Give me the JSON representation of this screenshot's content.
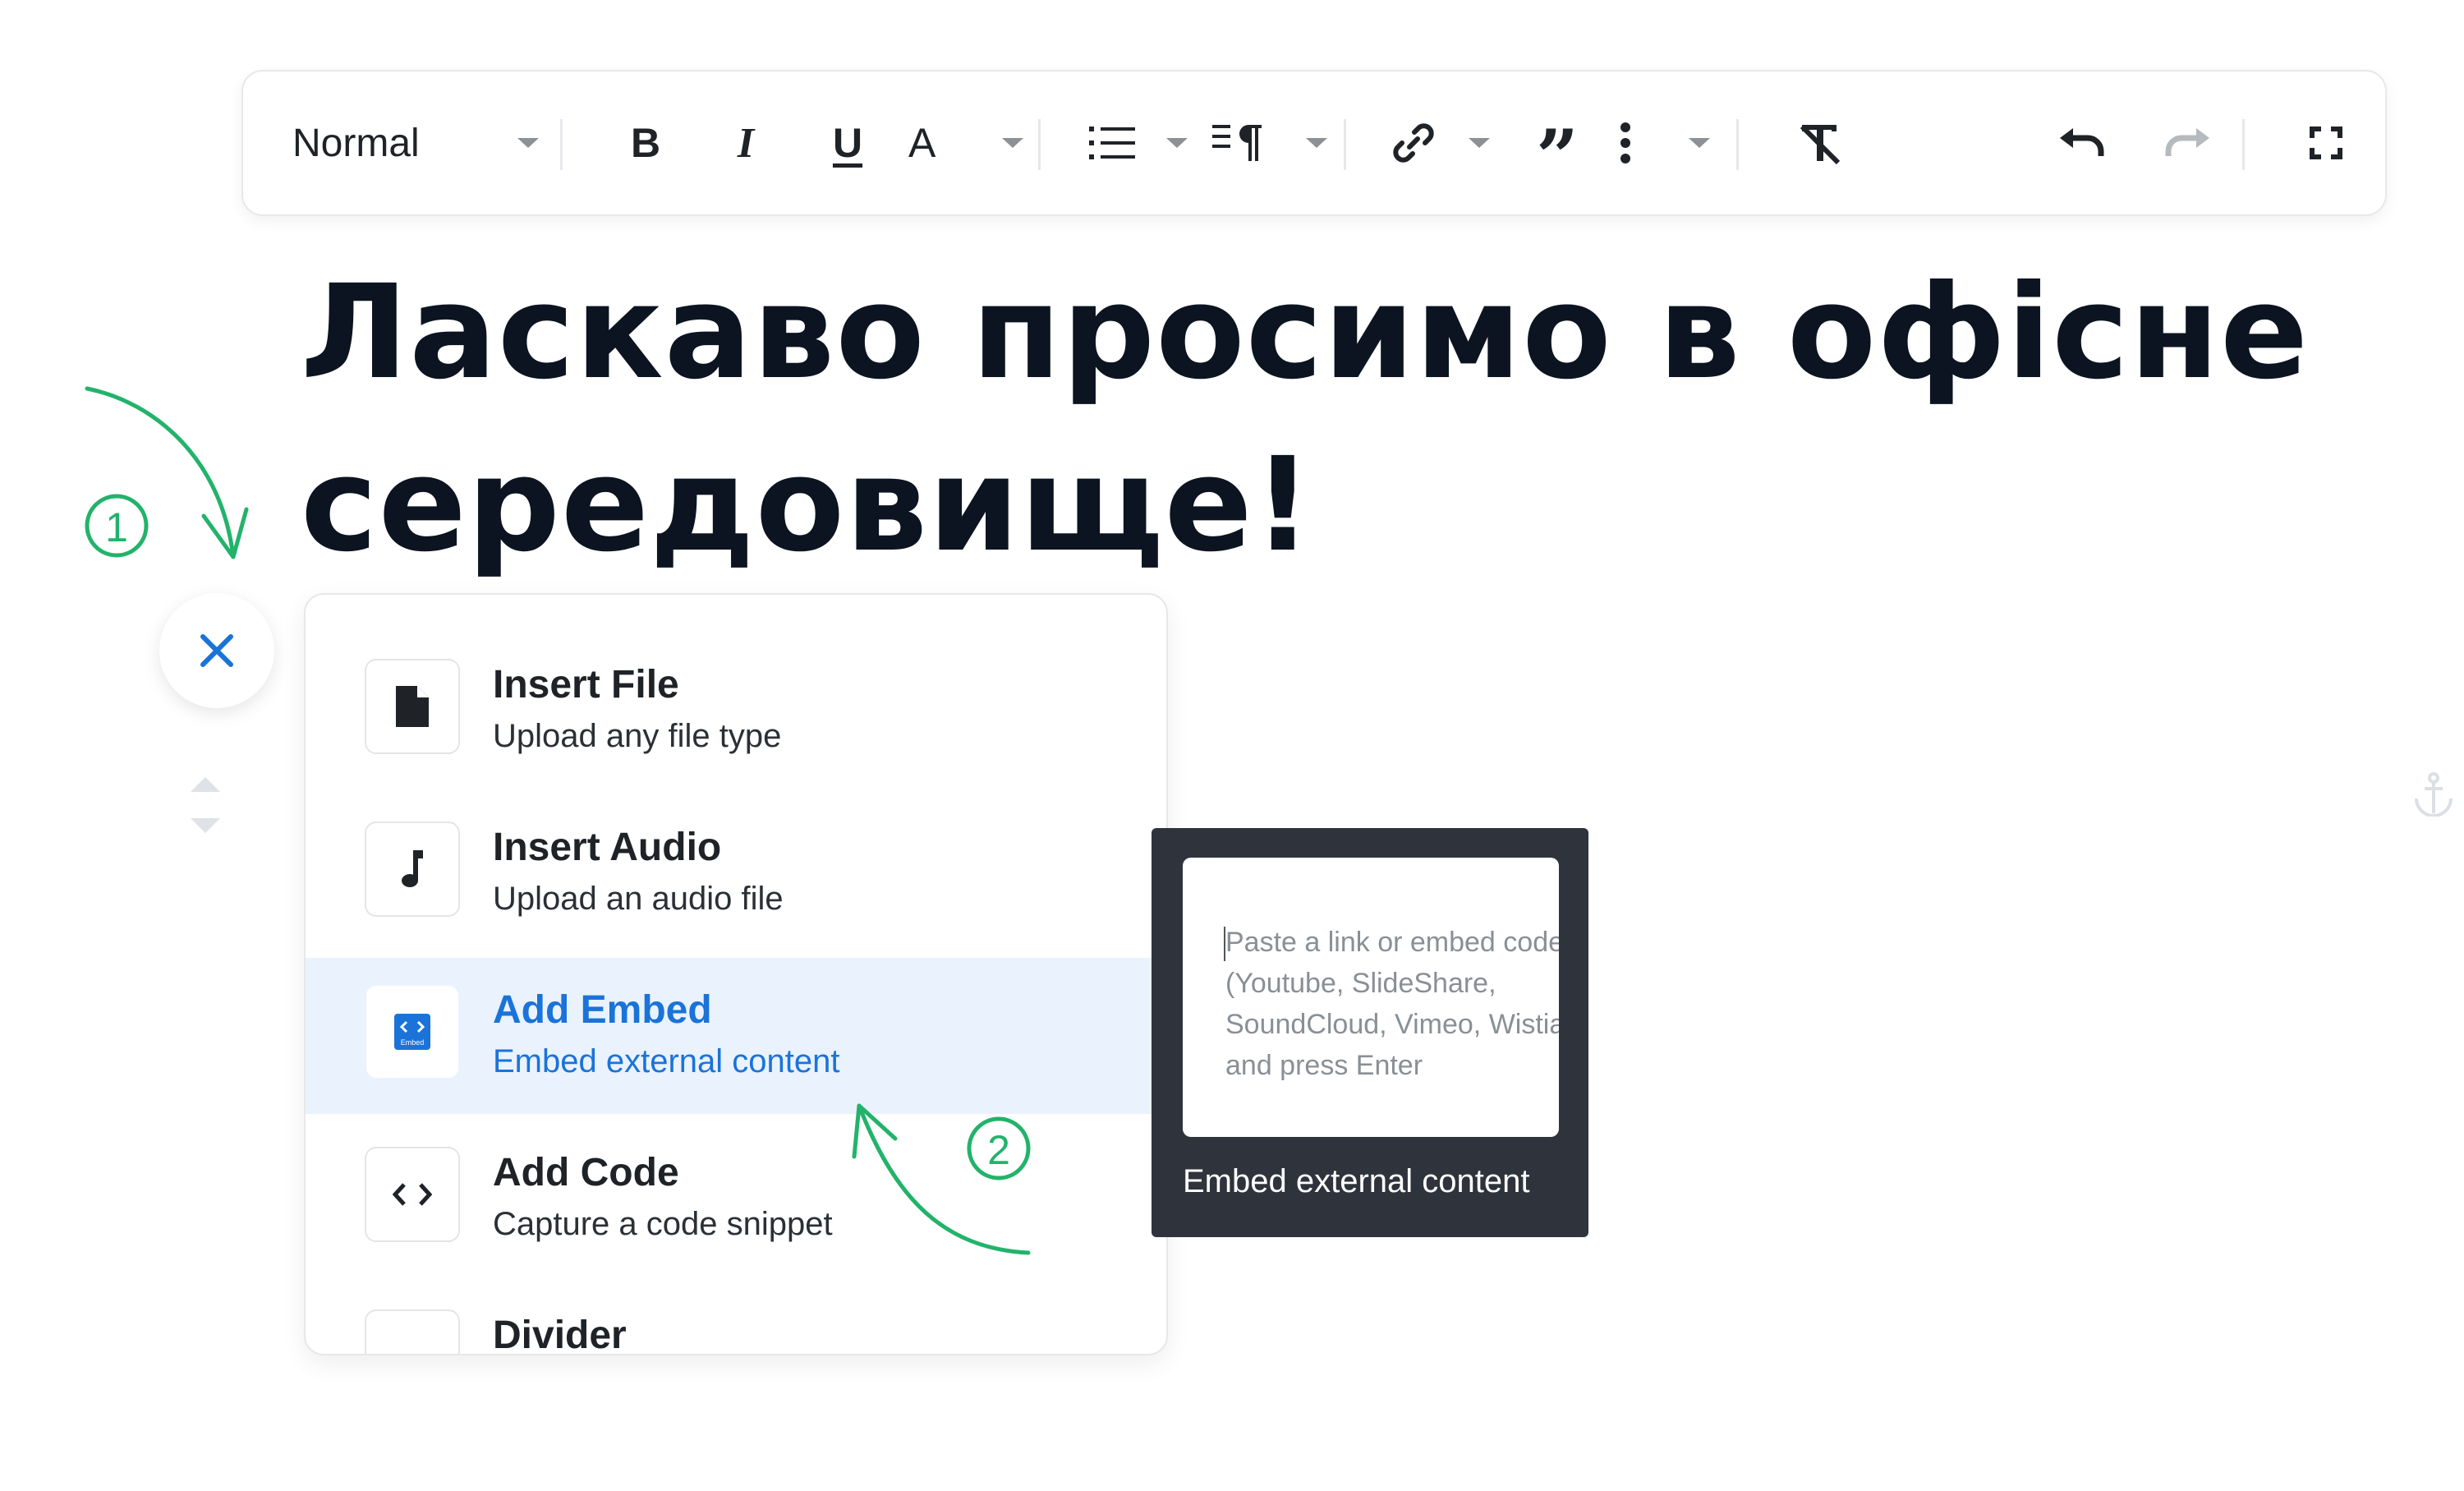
{
  "toolbar": {
    "style_select": "Normal",
    "icons": [
      "bold-icon",
      "italic-icon",
      "underline-icon",
      "text-color-icon",
      "list-icon",
      "paragraph-icon",
      "link-icon",
      "quote-icon",
      "more-icon",
      "clear-format-icon",
      "undo-icon",
      "redo-icon",
      "fullscreen-icon"
    ],
    "bold": "B",
    "italic": "I",
    "underline": "U",
    "text_color": "A",
    "quote": "”"
  },
  "heading": "Ласкаво просимо в офісне середовище!",
  "insert_menu": {
    "items": [
      {
        "title": "Insert File",
        "description": "Upload any file type",
        "icon": "file-icon"
      },
      {
        "title": "Insert Audio",
        "description": "Upload an audio file",
        "icon": "music-note-icon"
      },
      {
        "title": "Add Embed",
        "description": "Embed external content",
        "icon": "embed-icon",
        "active": true
      },
      {
        "title": "Add Code",
        "description": "Capture a code snippet",
        "icon": "code-icon"
      },
      {
        "title": "Divider",
        "description": "",
        "icon": "divider-icon"
      }
    ]
  },
  "embed_preview": {
    "placeholder": "Paste a link or embed code\n(Youtube, SlideShare,\nSoundCloud, Vimeo, Wistia)\nand press Enter",
    "caption": "Embed external content",
    "embed_icon_text": "Embed"
  },
  "annotations": {
    "step1": "1",
    "step2": "2",
    "color": "#22b36b"
  },
  "colors": {
    "accent": "#1a73d9",
    "active_bg": "#eaf2fd",
    "tooltip_bg": "#2f343c",
    "headline": "#0b1420"
  }
}
